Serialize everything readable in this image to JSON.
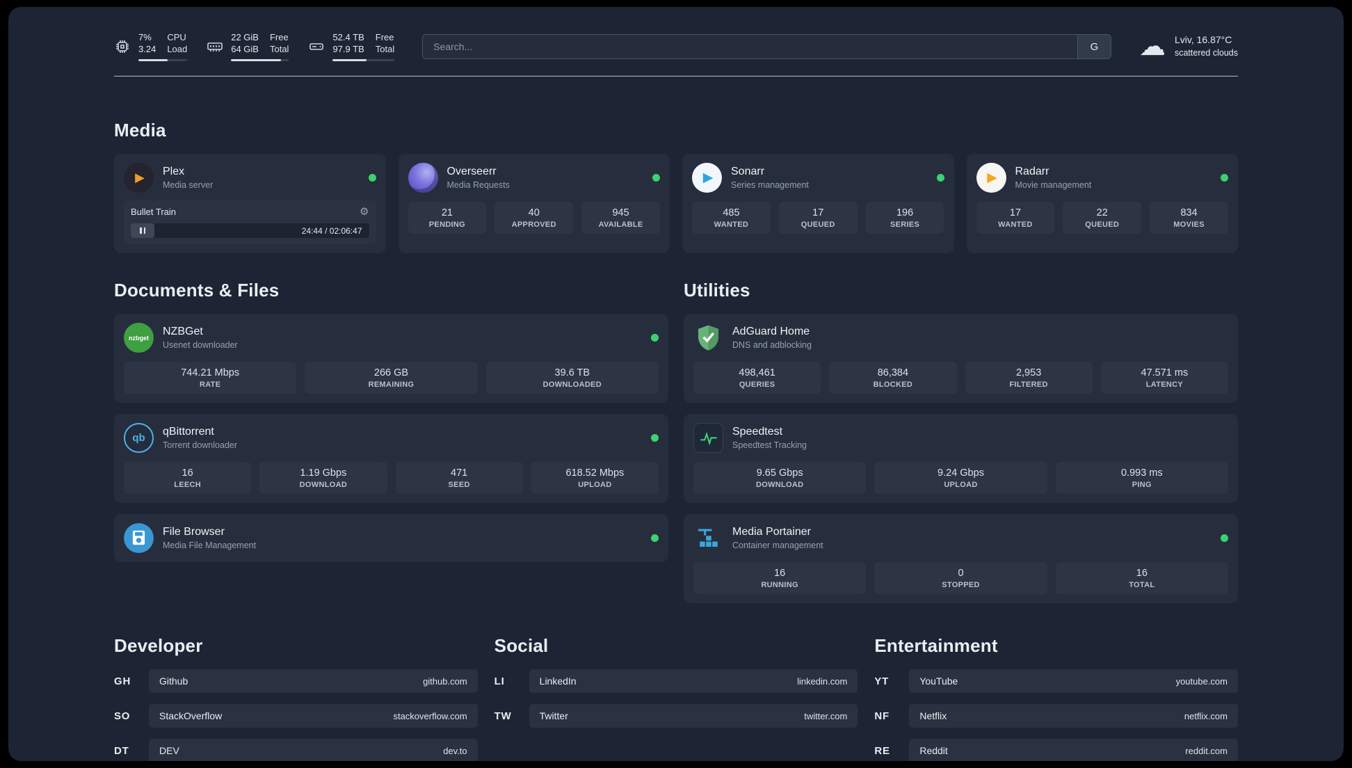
{
  "theme": {
    "background": "#1d2534",
    "card": "#262e3d",
    "tile": "#2d3545",
    "status_online": "#3ed171",
    "plex_gold": "#e8a02a",
    "adguard_green": "#67b279",
    "portainer_blue": "#3aa9e0"
  },
  "header": {
    "cpu": {
      "value_top": "7%",
      "value_bottom": "3.24",
      "label_top": "CPU",
      "label_bottom": "Load",
      "progress_pct": 60
    },
    "memory": {
      "value_top": "22 GiB",
      "value_bottom": "64 GiB",
      "label_top": "Free",
      "label_bottom": "Total",
      "progress_pct": 86
    },
    "disk": {
      "value_top": "52.4 TB",
      "value_bottom": "97.9 TB",
      "label_top": "Free",
      "label_bottom": "Total",
      "progress_pct": 55
    },
    "search": {
      "placeholder": "Search...",
      "engine_label": "G"
    },
    "weather": {
      "location": "Lviv, 16.87°C",
      "condition": "scattered clouds"
    }
  },
  "sections": {
    "media": "Media",
    "documents": "Documents & Files",
    "utilities": "Utilities",
    "developer": "Developer",
    "social": "Social",
    "entertainment": "Entertainment"
  },
  "apps": {
    "plex": {
      "name": "Plex",
      "desc": "Media server",
      "now_playing": {
        "title": "Bullet Train",
        "time": "24:44 / 02:06:47",
        "progress_pct": 10
      }
    },
    "overseerr": {
      "name": "Overseerr",
      "desc": "Media Requests",
      "stats": [
        {
          "value": "21",
          "label": "PENDING"
        },
        {
          "value": "40",
          "label": "APPROVED"
        },
        {
          "value": "945",
          "label": "AVAILABLE"
        }
      ]
    },
    "sonarr": {
      "name": "Sonarr",
      "desc": "Series management",
      "stats": [
        {
          "value": "485",
          "label": "WANTED"
        },
        {
          "value": "17",
          "label": "QUEUED"
        },
        {
          "value": "196",
          "label": "SERIES"
        }
      ]
    },
    "radarr": {
      "name": "Radarr",
      "desc": "Movie management",
      "stats": [
        {
          "value": "17",
          "label": "WANTED"
        },
        {
          "value": "22",
          "label": "QUEUED"
        },
        {
          "value": "834",
          "label": "MOVIES"
        }
      ]
    },
    "nzbget": {
      "name": "NZBGet",
      "desc": "Usenet downloader",
      "icon_text": "nzbget",
      "stats": [
        {
          "value": "744.21 Mbps",
          "label": "RATE"
        },
        {
          "value": "266 GB",
          "label": "REMAINING"
        },
        {
          "value": "39.6 TB",
          "label": "DOWNLOADED"
        }
      ]
    },
    "qbittorrent": {
      "name": "qBittorrent",
      "desc": "Torrent downloader",
      "icon_text": "qb",
      "stats": [
        {
          "value": "16",
          "label": "LEECH"
        },
        {
          "value": "1.19 Gbps",
          "label": "DOWNLOAD"
        },
        {
          "value": "471",
          "label": "SEED"
        },
        {
          "value": "618.52 Mbps",
          "label": "UPLOAD"
        }
      ]
    },
    "filebrowser": {
      "name": "File Browser",
      "desc": "Media File Management"
    },
    "adguard": {
      "name": "AdGuard Home",
      "desc": "DNS and adblocking",
      "stats": [
        {
          "value": "498,461",
          "label": "QUERIES"
        },
        {
          "value": "86,384",
          "label": "BLOCKED"
        },
        {
          "value": "2,953",
          "label": "FILTERED"
        },
        {
          "value": "47.571 ms",
          "label": "LATENCY"
        }
      ]
    },
    "speedtest": {
      "name": "Speedtest",
      "desc": "Speedtest Tracking",
      "stats": [
        {
          "value": "9.65 Gbps",
          "label": "DOWNLOAD"
        },
        {
          "value": "9.24 Gbps",
          "label": "UPLOAD"
        },
        {
          "value": "0.993 ms",
          "label": "PING"
        }
      ]
    },
    "portainer": {
      "name": "Media Portainer",
      "desc": "Container management",
      "stats": [
        {
          "value": "16",
          "label": "RUNNING"
        },
        {
          "value": "0",
          "label": "STOPPED"
        },
        {
          "value": "16",
          "label": "TOTAL"
        }
      ]
    }
  },
  "bookmarks": {
    "developer": [
      {
        "abbr": "GH",
        "name": "Github",
        "url": "github.com"
      },
      {
        "abbr": "SO",
        "name": "StackOverflow",
        "url": "stackoverflow.com"
      },
      {
        "abbr": "DT",
        "name": "DEV",
        "url": "dev.to"
      }
    ],
    "social": [
      {
        "abbr": "LI",
        "name": "LinkedIn",
        "url": "linkedin.com"
      },
      {
        "abbr": "TW",
        "name": "Twitter",
        "url": "twitter.com"
      }
    ],
    "entertainment": [
      {
        "abbr": "YT",
        "name": "YouTube",
        "url": "youtube.com"
      },
      {
        "abbr": "NF",
        "name": "Netflix",
        "url": "netflix.com"
      },
      {
        "abbr": "RE",
        "name": "Reddit",
        "url": "reddit.com"
      }
    ]
  }
}
